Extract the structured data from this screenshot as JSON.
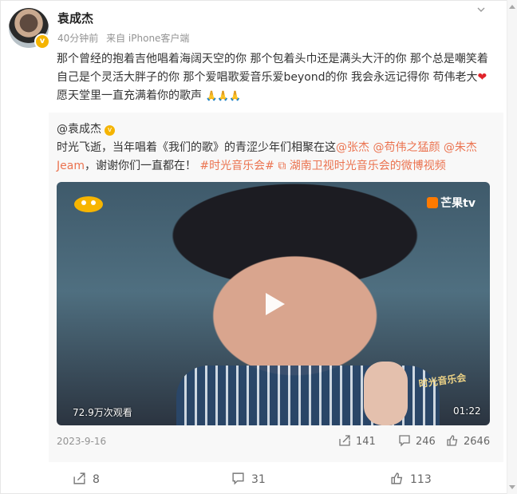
{
  "user": {
    "name": "袁成杰",
    "time": "40分钟前",
    "source": "来自 iPhone客户端"
  },
  "post": {
    "text": "那个曾经的抱着吉他唱着海阔天空的你 那个包着头巾还是满头大汗的你 那个总是嘲笑着自己是个灵活大胖子的你 那个爱唱歌爱音乐爱beyond的你 我会永远记得你 苟伟老大",
    "after_heart": " 愿天堂里一直充满着你的歌声",
    "emoji_pray": "🙏🙏🙏"
  },
  "repost": {
    "author": "@袁成杰",
    "text_before": "时光飞逝，当年唱着《我们的歌》的青涩少年们相聚在这",
    "mentions": [
      "@张杰",
      "@苟伟之猛颜",
      "@朱杰 Jeam"
    ],
    "text_after": "，谢谢你们一直都在！",
    "topic": "#时光音乐会#",
    "video_link": "湖南卫视时光音乐会的微博视频",
    "date": "2023-9-16",
    "shares": "141",
    "comments": "246",
    "likes": "2646",
    "video": {
      "views": "72.9万次观看",
      "duration": "01:22",
      "channel_logo": "芒果tv",
      "watermark": "时光音乐会"
    }
  },
  "actions": {
    "shares": "8",
    "comments": "31",
    "likes": "113"
  }
}
